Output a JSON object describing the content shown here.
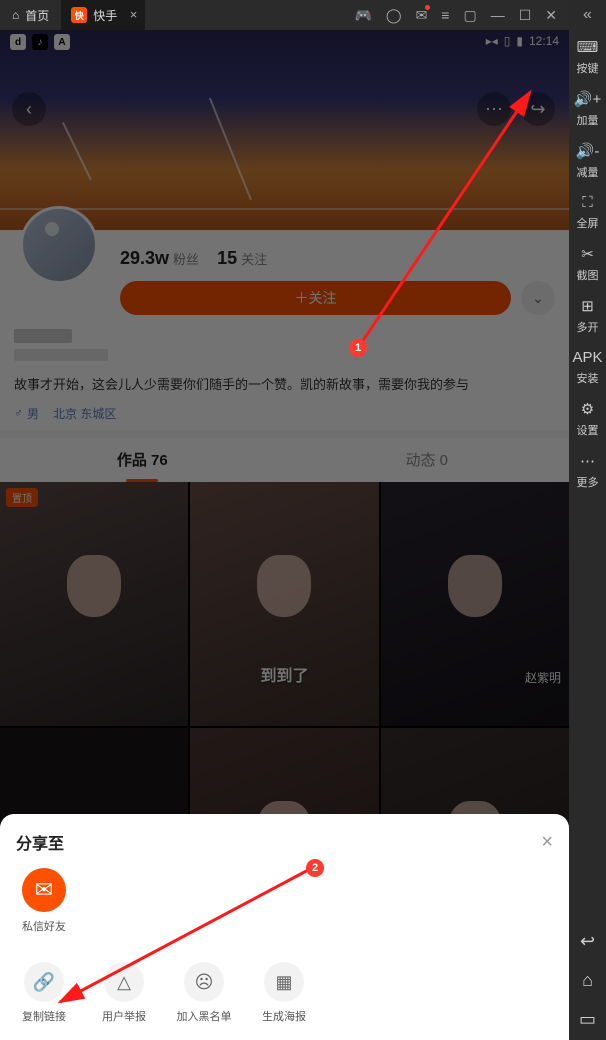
{
  "titlebar": {
    "home_label": "首页",
    "app_label": "快手",
    "app_icon_text": "快"
  },
  "statusbar": {
    "time": "12:14"
  },
  "profile": {
    "fans_count": "29.3w",
    "fans_label": "粉丝",
    "follow_count": "15",
    "follow_label": "关注",
    "follow_btn": "＋关注",
    "bio": "故事才开始，这会儿人少需要你们随手的一个赞。凯的新故事，需要你我的参与",
    "gender": "男",
    "location": "北京 东城区"
  },
  "tabs": {
    "works": "作品 76",
    "moments": "动态 0"
  },
  "grid": {
    "pin_badge": "置顶",
    "cap2": "到到了",
    "cap3": "赵紫明"
  },
  "sheet": {
    "title": "分享至",
    "friend": "私信好友",
    "copy": "复制链接",
    "report": "用户举报",
    "blacklist": "加入黑名单",
    "poster": "生成海报"
  },
  "side": {
    "keys": "按键",
    "vol_up": "加量",
    "vol_down": "减量",
    "fullscreen": "全屏",
    "snip": "截图",
    "multi": "多开",
    "install": "安装",
    "settings": "设置",
    "more": "更多"
  },
  "annotations": {
    "n1": "1",
    "n2": "2"
  }
}
